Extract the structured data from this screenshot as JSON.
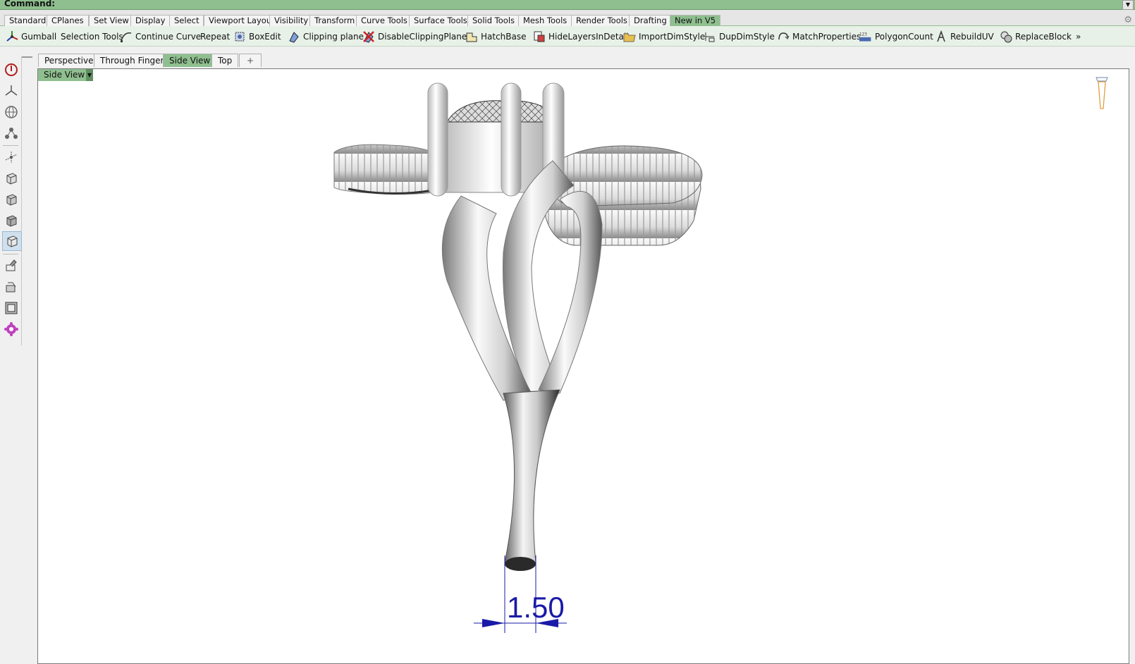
{
  "command": {
    "label": "Command:"
  },
  "tabs": [
    {
      "label": "Standard"
    },
    {
      "label": "CPlanes"
    },
    {
      "label": "Set View"
    },
    {
      "label": "Display"
    },
    {
      "label": "Select"
    },
    {
      "label": "Viewport Layout"
    },
    {
      "label": "Visibility"
    },
    {
      "label": "Transform"
    },
    {
      "label": "Curve Tools"
    },
    {
      "label": "Surface Tools"
    },
    {
      "label": "Solid Tools"
    },
    {
      "label": "Mesh Tools"
    },
    {
      "label": "Render Tools"
    },
    {
      "label": "Drafting"
    },
    {
      "label": "New in V5"
    }
  ],
  "toolbar": {
    "gumball": "Gumball",
    "selection_tools": "Selection Tools",
    "continue_curve": "Continue Curve",
    "repeat": "Repeat",
    "boxedit": "BoxEdit",
    "clipping_plane": "Clipping plane",
    "disable_clipping": "DisableClippingPlane",
    "hatchbase": "HatchBase",
    "hide_layers": "HideLayersInDetail",
    "import_dim": "ImportDimStyle",
    "dup_dim": "DupDimStyle",
    "match_props": "MatchProperties",
    "polygon_count": "PolygonCount",
    "polygon_icon_text": "123",
    "rebuild_uv": "RebuildUV",
    "replace_block": "ReplaceBlock",
    "more": "»"
  },
  "viewport_tabs": [
    {
      "label": "Perspective"
    },
    {
      "label": "Through Finger"
    },
    {
      "label": "Side View"
    },
    {
      "label": "Top"
    },
    {
      "label": "+"
    }
  ],
  "viewport": {
    "title": "Side View",
    "dimension": "1.50"
  },
  "colors": {
    "accent": "#8fbf8f",
    "dimension": "#1a1aa8",
    "active_tab": "#8fbf8f"
  }
}
